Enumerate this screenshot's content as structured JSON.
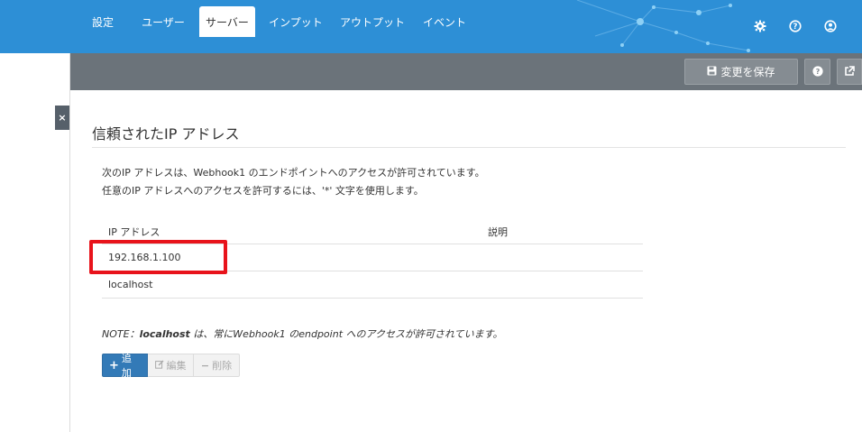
{
  "header": {
    "icons": [
      "gear-icon",
      "help-circle-icon",
      "user-circle-icon"
    ],
    "color": "#2d8fd6"
  },
  "sidebar": {
    "close_label": "×"
  },
  "tabs": [
    {
      "label": "設定"
    },
    {
      "label": "ユーザー"
    },
    {
      "label": "サーバー",
      "active": true
    },
    {
      "label": "インプット"
    },
    {
      "label": "アウトプット"
    },
    {
      "label": "イベント"
    }
  ],
  "toolbar": {
    "save_label": "変更を保存",
    "help_icon": "question-icon",
    "external_icon": "external-link-icon"
  },
  "section": {
    "title": "信頼されたIP アドレス",
    "desc_line1": "次のIP アドレスは、Webhook1 のエンドポイントへのアクセスが許可されています。",
    "desc_line2": "任意のIP アドレスへのアクセスを許可するには、'*' 文字を使用します。"
  },
  "table": {
    "columns": [
      "IP アドレス",
      "説明"
    ],
    "rows": [
      {
        "ip": "192.168.1.100",
        "description": ""
      },
      {
        "ip": "localhost",
        "description": ""
      }
    ]
  },
  "note": {
    "prefix": "NOTE：",
    "bold": "localhost",
    "rest": " は、常にWebhook1 のendpoint へのアクセスが許可されています。"
  },
  "buttons": {
    "add": "追加",
    "edit": "編集",
    "delete": "削除"
  },
  "colors": {
    "accent": "#337ab7",
    "highlight": "#e8131b",
    "tabbar": "#6b737a"
  }
}
